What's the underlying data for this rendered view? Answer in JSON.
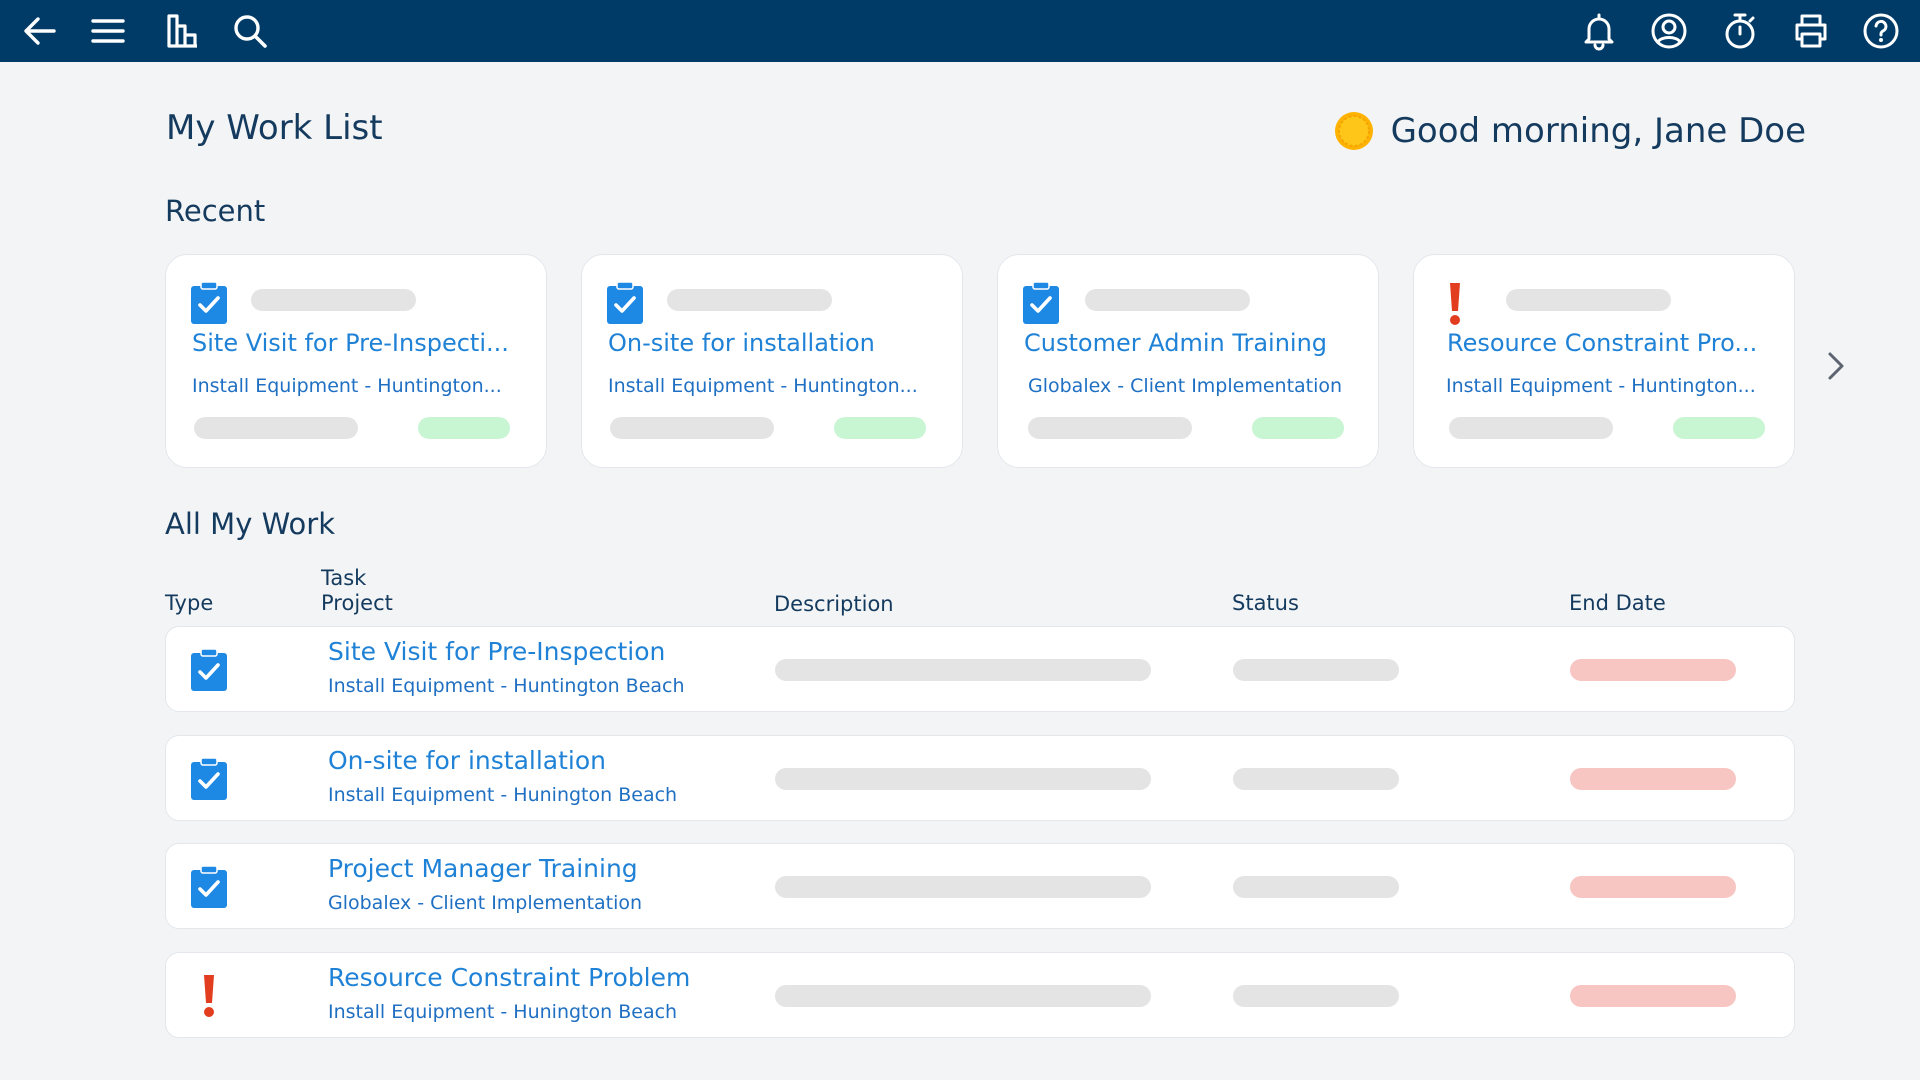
{
  "topbar": {
    "left_icons": [
      "back-arrow-icon",
      "menu-icon",
      "reports-icon",
      "search-icon"
    ],
    "right_icons": [
      "bell-icon",
      "user-icon",
      "timer-icon",
      "print-icon",
      "help-icon"
    ]
  },
  "page_title": "My Work List",
  "greeting": "Good morning, Jane Doe",
  "sections": {
    "recent": "Recent",
    "all": "All My Work"
  },
  "recent_cards": [
    {
      "type": "task",
      "title": "Site Visit for Pre-Inspecti...",
      "project": "Install Equipment - Huntington..."
    },
    {
      "type": "task",
      "title": "On-site for installation",
      "project": "Install Equipment - Huntington..."
    },
    {
      "type": "task",
      "title": "Customer Admin Training",
      "project": "Globalex - Client Implementation"
    },
    {
      "type": "issue",
      "title": "Resource Constraint Pro...",
      "project": "Install Equipment - Huntington..."
    }
  ],
  "table": {
    "headers": {
      "type": "Type",
      "task": "Task",
      "project": "Project",
      "description": "Description",
      "status": "Status",
      "end_date": "End Date"
    },
    "rows": [
      {
        "type": "task",
        "task": "Site Visit for Pre-Inspection",
        "project": "Install Equipment - Huntington Beach"
      },
      {
        "type": "task",
        "task": "On-site for installation",
        "project": "Install Equipment - Hunington Beach"
      },
      {
        "type": "task",
        "task": "Project Manager Training",
        "project": "Globalex - Client Implementation"
      },
      {
        "type": "issue",
        "task": "Resource Constraint Problem",
        "project": "Install Equipment - Hunington Beach"
      }
    ]
  },
  "colors": {
    "topbar": "#003a67",
    "link": "#1f82d6",
    "task_icon": "#1e88e5",
    "issue_icon": "#e23d1f",
    "skeleton": "#e4e4e4",
    "status_green": "#c8f5d2",
    "date_red": "#f7c6c2"
  }
}
